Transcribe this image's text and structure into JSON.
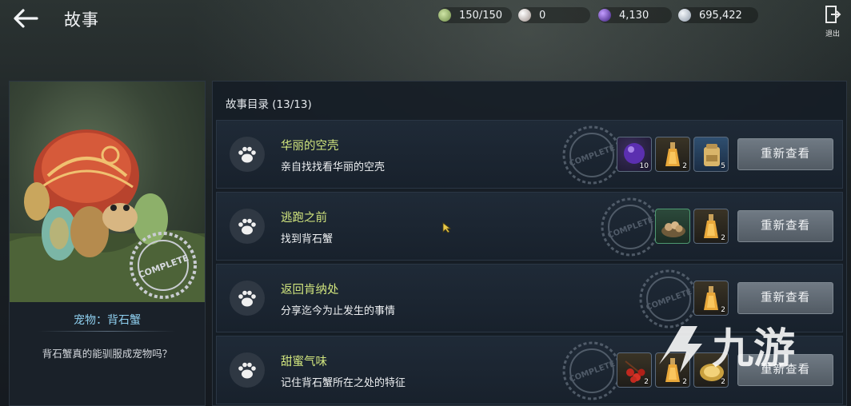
{
  "header": {
    "title": "故事",
    "currencies": [
      {
        "icon": "energy-icon",
        "value": "150/150"
      },
      {
        "icon": "pearl-icon",
        "value": "0"
      },
      {
        "icon": "purple-orb-icon",
        "value": "4,130"
      },
      {
        "icon": "silver-coin-icon",
        "value": "695,422"
      }
    ],
    "exit_label": "退出"
  },
  "pet": {
    "name": "宠物：背石蟹",
    "question": "背石蟹真的能驯服成宠物吗？",
    "stamp_text": "COMPLETE"
  },
  "story_list": {
    "header": "故事目录 (13/13)",
    "button_label": "重新查看",
    "stamp_text": "COMPLETE",
    "items": [
      {
        "title": "华丽的空壳",
        "desc": "亲自找找看华丽的空壳",
        "rewards": [
          {
            "icon": "purple-orb-icon",
            "count": "10"
          },
          {
            "icon": "potion-bottle-icon",
            "count": "2"
          },
          {
            "icon": "backpack-icon",
            "count": "5"
          }
        ]
      },
      {
        "title": "逃跑之前",
        "desc": "找到背石蟹",
        "rewards": [
          {
            "icon": "food-bowl-icon",
            "count": ""
          },
          {
            "icon": "potion-bottle-icon",
            "count": "2"
          }
        ]
      },
      {
        "title": "返回肯纳处",
        "desc": "分享迄今为止发生的事情",
        "rewards": [
          {
            "icon": "potion-bottle-icon",
            "count": "2"
          }
        ]
      },
      {
        "title": "甜蜜气味",
        "desc": "记住背石蟹所在之处的特征",
        "rewards": [
          {
            "icon": "red-berries-icon",
            "count": "2"
          },
          {
            "icon": "potion-bottle-icon",
            "count": "2"
          },
          {
            "icon": "gold-plate-icon",
            "count": "2"
          }
        ]
      }
    ]
  },
  "watermark": {
    "text": "九游"
  },
  "colors": {
    "story_title": "#d2e67e",
    "pet_name": "#8fd0f0",
    "button_bg": "#5f6872",
    "panel_bg": "#18212c"
  }
}
